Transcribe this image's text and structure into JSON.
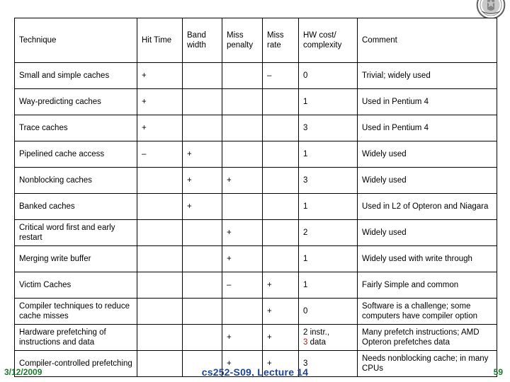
{
  "slide": {
    "logo_icon": "university-seal-icon"
  },
  "table": {
    "headers": [
      {
        "label": "Technique",
        "style": "big"
      },
      {
        "label": "Hit Time",
        "style": "small"
      },
      {
        "label": "Band width",
        "style": "small"
      },
      {
        "label": "Miss penalty",
        "style": "small"
      },
      {
        "label": "Miss rate",
        "style": "small"
      },
      {
        "label": "HW cost/ complexity",
        "style": "small"
      },
      {
        "label": "Comment",
        "style": "big"
      }
    ],
    "rows": [
      {
        "technique": "Small and simple caches",
        "hit_time": "+",
        "hit_time_color": "green",
        "bandwidth": "",
        "bandwidth_color": "",
        "miss_penalty": "",
        "miss_penalty_color": "",
        "miss_rate": "–",
        "miss_rate_color": "red",
        "hw_cost": "0",
        "hw_cost_color": "green",
        "comment": "Trivial; widely used"
      },
      {
        "technique": "Way-predicting caches",
        "hit_time": "+",
        "hit_time_color": "green",
        "bandwidth": "",
        "bandwidth_color": "",
        "miss_penalty": "",
        "miss_penalty_color": "",
        "miss_rate": "",
        "miss_rate_color": "",
        "hw_cost": "1",
        "hw_cost_color": "green",
        "comment": "Used in Pentium 4"
      },
      {
        "technique": "Trace caches",
        "hit_time": "+",
        "hit_time_color": "green",
        "bandwidth": "",
        "bandwidth_color": "",
        "miss_penalty": "",
        "miss_penalty_color": "",
        "miss_rate": "",
        "miss_rate_color": "",
        "hw_cost": "3",
        "hw_cost_color": "red",
        "comment": "Used in Pentium 4"
      },
      {
        "technique": "Pipelined cache access",
        "hit_time": "–",
        "hit_time_color": "red",
        "bandwidth": "+",
        "bandwidth_color": "green",
        "miss_penalty": "",
        "miss_penalty_color": "",
        "miss_rate": "",
        "miss_rate_color": "",
        "hw_cost": "1",
        "hw_cost_color": "green",
        "comment": "Widely used"
      },
      {
        "technique": "Nonblocking caches",
        "hit_time": "",
        "hit_time_color": "",
        "bandwidth": "+",
        "bandwidth_color": "green",
        "miss_penalty": "+",
        "miss_penalty_color": "green",
        "miss_rate": "",
        "miss_rate_color": "",
        "hw_cost": "3",
        "hw_cost_color": "red",
        "comment": "Widely used"
      },
      {
        "technique": "Banked caches",
        "hit_time": "",
        "hit_time_color": "",
        "bandwidth": "+",
        "bandwidth_color": "green",
        "miss_penalty": "",
        "miss_penalty_color": "",
        "miss_rate": "",
        "miss_rate_color": "",
        "hw_cost": "1",
        "hw_cost_color": "green",
        "comment": "Used in L2 of Opteron and Niagara"
      },
      {
        "technique": "Critical word first and early restart",
        "hit_time": "",
        "hit_time_color": "",
        "bandwidth": "",
        "bandwidth_color": "",
        "miss_penalty": "+",
        "miss_penalty_color": "green",
        "miss_rate": "",
        "miss_rate_color": "",
        "hw_cost": "2",
        "hw_cost_color": "black",
        "comment": "Widely used"
      },
      {
        "technique": "Merging write buffer",
        "hit_time": "",
        "hit_time_color": "",
        "bandwidth": "",
        "bandwidth_color": "",
        "miss_penalty": "+",
        "miss_penalty_color": "green",
        "miss_rate": "",
        "miss_rate_color": "",
        "hw_cost": "1",
        "hw_cost_color": "green",
        "comment": "Widely used with write through"
      },
      {
        "technique": "Victim Caches",
        "hit_time": "",
        "hit_time_color": "",
        "bandwidth": "",
        "bandwidth_color": "",
        "miss_penalty": "–",
        "miss_penalty_color": "red",
        "miss_rate": "+",
        "miss_rate_color": "green",
        "hw_cost": "1",
        "hw_cost_color": "green",
        "comment": "Fairly Simple and common"
      },
      {
        "technique": "Compiler techniques to reduce cache misses",
        "hit_time": "",
        "hit_time_color": "",
        "bandwidth": "",
        "bandwidth_color": "",
        "miss_penalty": "",
        "miss_penalty_color": "",
        "miss_rate": "+",
        "miss_rate_color": "green",
        "hw_cost": "0",
        "hw_cost_color": "green",
        "comment": "Software is a challenge; some computers have compiler option"
      },
      {
        "technique": "Hardware prefetching of instructions and data",
        "hit_time": "",
        "hit_time_color": "",
        "bandwidth": "",
        "bandwidth_color": "",
        "miss_penalty": "+",
        "miss_penalty_color": "green",
        "miss_rate": "+",
        "miss_rate_color": "green",
        "hw_cost": "2 instr., 3 data",
        "hw_cost_color": "mixed",
        "hw_cost_parts": [
          {
            "text": "2 instr.,",
            "color": "black"
          },
          {
            "text": "3",
            "color": "red"
          },
          {
            "text": " data",
            "color": "black"
          }
        ],
        "comment": "Many prefetch instructions; AMD Opteron prefetches data"
      },
      {
        "technique": "Compiler-controlled prefetching",
        "hit_time": "",
        "hit_time_color": "",
        "bandwidth": "",
        "bandwidth_color": "",
        "miss_penalty": "+",
        "miss_penalty_color": "green",
        "miss_rate": "+",
        "miss_rate_color": "green",
        "hw_cost": "3",
        "hw_cost_color": "red",
        "comment": "Needs nonblocking cache; in many CPUs"
      }
    ]
  },
  "footer": {
    "date": "3/12/2009",
    "center": "cs252-S09, Lecture 14",
    "page": "59"
  }
}
